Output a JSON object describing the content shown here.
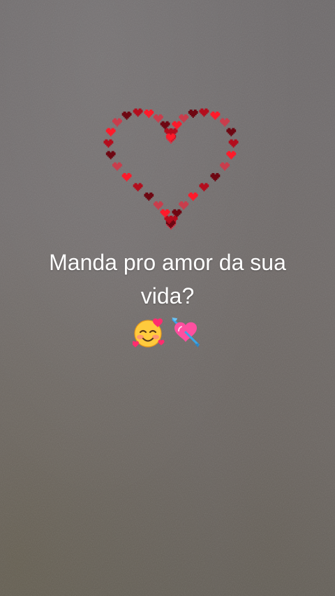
{
  "caption": {
    "line1": "Manda pro amor da sua",
    "line2": "vida?"
  },
  "emojis": [
    {
      "icon": "smiling-face-with-hearts-icon"
    },
    {
      "icon": "heart-with-arrow-icon"
    }
  ],
  "decoration": {
    "icon": "heart-outline-of-small-hearts-icon",
    "colors": [
      "#ff1a2a",
      "#b30d1d",
      "#6e0712",
      "#c93d4c"
    ]
  },
  "palette": {
    "background": "#6f6a6b",
    "text": "#ffffff"
  }
}
